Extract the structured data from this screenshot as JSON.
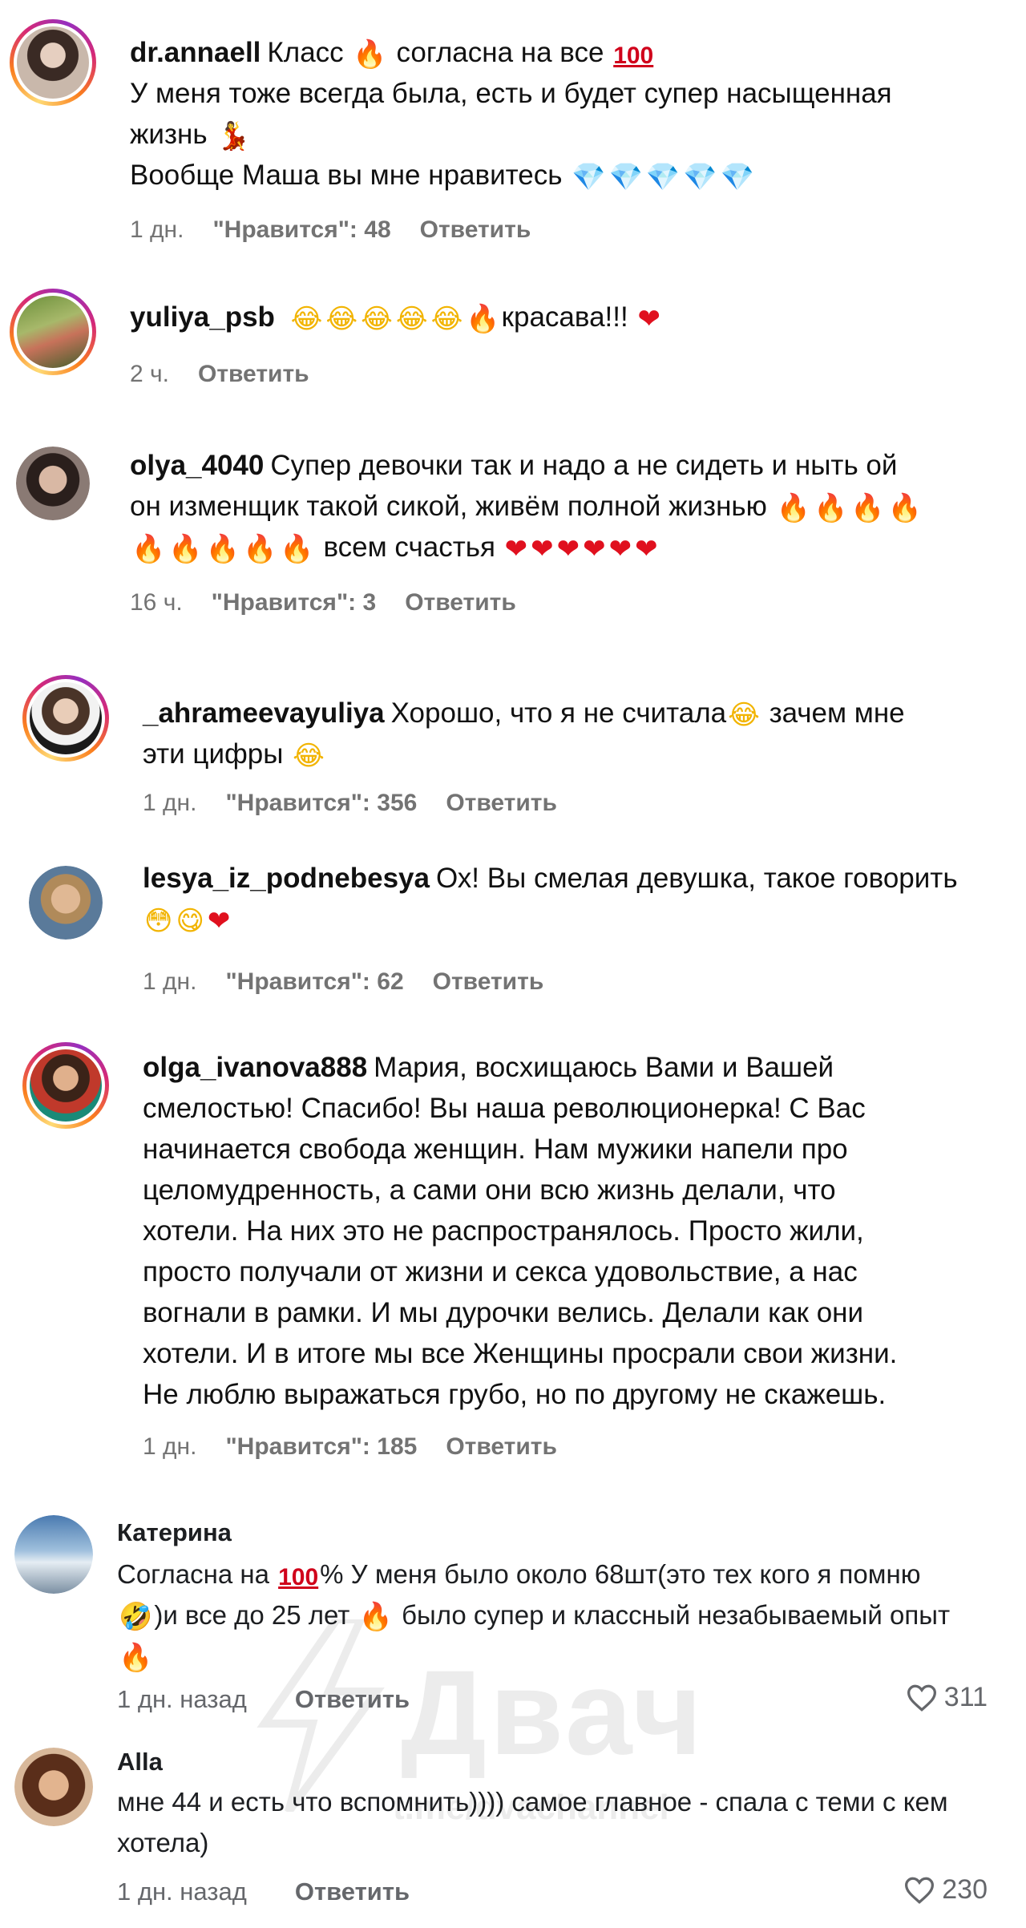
{
  "comments": [
    {
      "username": "dr.annaell",
      "text_line1": "Класс",
      "text_line1b": "согласна на все",
      "text_line2": "У меня тоже всегда была, есть и будет супер насыщенная",
      "text_line3": "жизнь",
      "text_line4": "Вообще Маша вы мне нравитесь",
      "time": "1 дн.",
      "likes": "\"Нравится\": 48",
      "reply": "Ответить"
    },
    {
      "username": "yuliya_psb",
      "text": "красава!!!",
      "time": "2 ч.",
      "reply": "Ответить"
    },
    {
      "username": "olya_4040",
      "text_line1": "Супер девочки так и надо а не сидеть и ныть ой",
      "text_line2": "он изменщик такой сикой, живём полной жизнью",
      "text_line3": "всем счастья",
      "time": "16 ч.",
      "likes": "\"Нравится\": 3",
      "reply": "Ответить"
    },
    {
      "username": "_ahrameevayuliya",
      "text_line1": "Хорошо, что я не считала",
      "text_line1b": "зачем мне",
      "text_line2": "эти цифры",
      "time": "1 дн.",
      "likes": "\"Нравится\": 356",
      "reply": "Ответить"
    },
    {
      "username": "lesya_iz_podnebesya",
      "text_line1": "Ох! Вы смелая девушка, такое говорить",
      "time": "1 дн.",
      "likes": "\"Нравится\": 62",
      "reply": "Ответить"
    },
    {
      "username": "olga_ivanova888",
      "lines": [
        "Мария, восхищаюсь Вами и Вашей",
        "смелостью! Спасибо! Вы наша революционерка! С Вас",
        "начинается свобода женщин. Нам мужики напели про",
        "целомудренность, а сами они всю жизнь делали, что",
        "хотели. На них это не распространялось. Просто жили,",
        "просто получали от жизни и секса удовольствие, а нас",
        "вогнали в рамки. И мы дурочки велись. Делали как они",
        "хотели. И в итоге мы все Женщины просрали свои жизни.",
        "Не люблю выражаться грубо, но по другому не скажешь."
      ],
      "time": "1 дн.",
      "likes": "\"Нравится\": 185",
      "reply": "Ответить"
    }
  ],
  "fb_comments": [
    {
      "name": "Катерина",
      "line1a": "Согласна на",
      "line1b": "% У меня было около 68шт(это тех кого я помню",
      "line2": ")и все до 25 лет",
      "line2b": "было супер и классный незабываемый опыт",
      "time": "1 дн. назад",
      "reply": "Ответить",
      "likes": "311"
    },
    {
      "name": "Alla",
      "line1": "мне 44 и есть что вспомнить)))) самое главное - спала с теми с кем",
      "line2": "хотела)",
      "time": "1 дн. назад",
      "reply": "Ответить",
      "likes": "230"
    }
  ],
  "watermark": {
    "logo_text": "Двач",
    "url": "t.me/dvachannel"
  },
  "colors": {
    "meta_gray": "#737373",
    "heart_red": "#e0101e",
    "fire_orange": "#ff6a00",
    "story_ring": "#d62976"
  }
}
